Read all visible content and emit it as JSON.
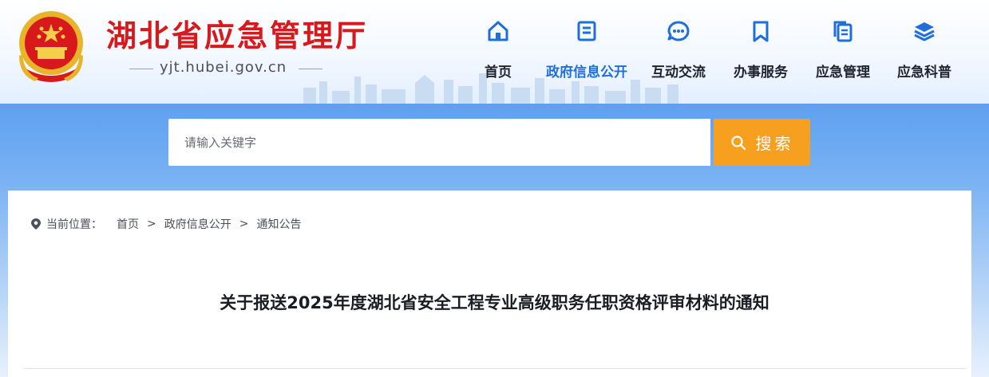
{
  "header": {
    "site_name": "湖北省应急管理厅",
    "site_domain": "yjt.hubei.gov.cn"
  },
  "nav": {
    "items": [
      {
        "label": "首页",
        "icon": "home-icon"
      },
      {
        "label": "政府信息公开",
        "icon": "document-list-icon",
        "active": true
      },
      {
        "label": "互动交流",
        "icon": "chat-bubble-icon"
      },
      {
        "label": "办事服务",
        "icon": "bookmark-icon"
      },
      {
        "label": "应急管理",
        "icon": "copy-docs-icon"
      },
      {
        "label": "应急科普",
        "icon": "layers-icon"
      }
    ]
  },
  "search": {
    "placeholder": "请输入关键字",
    "button_label": "搜索"
  },
  "breadcrumb": {
    "label": "当前位置：",
    "items": [
      "首页",
      "政府信息公开",
      "通知公告"
    ],
    "separator": ">"
  },
  "article": {
    "title": "关于报送2025年度湖北省安全工程专业高级职务任职资格评审材料的通知"
  },
  "colors": {
    "brand_red": "#d8191c",
    "nav_active": "#1e6fd9",
    "search_button": "#f7a01f",
    "band_blue": "#5ea0f0"
  }
}
